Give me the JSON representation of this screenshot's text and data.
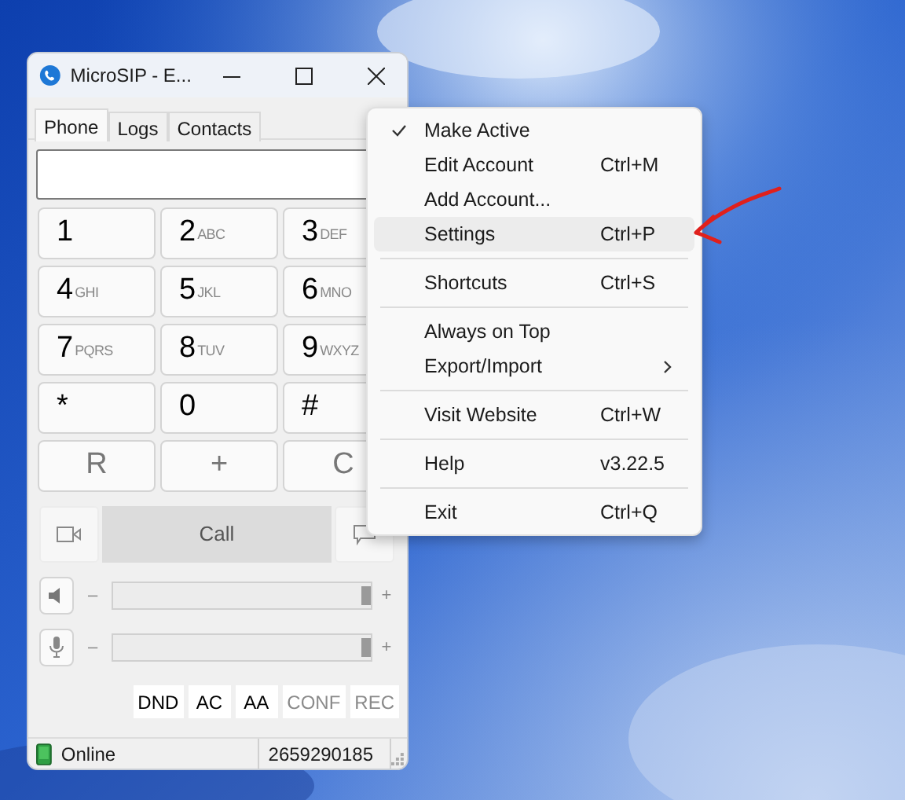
{
  "window": {
    "title": "MicroSIP - E..."
  },
  "tabs": [
    {
      "label": "Phone",
      "selected": true
    },
    {
      "label": "Logs",
      "selected": false
    },
    {
      "label": "Contacts",
      "selected": false
    }
  ],
  "keypad": [
    [
      {
        "kind": "digit",
        "main": "1"
      },
      {
        "kind": "digit",
        "main": "2",
        "sub": "ABC"
      },
      {
        "kind": "digit",
        "main": "3",
        "sub": "DEF"
      }
    ],
    [
      {
        "kind": "digit",
        "main": "4",
        "sub": "GHI"
      },
      {
        "kind": "digit",
        "main": "5",
        "sub": "JKL"
      },
      {
        "kind": "digit",
        "main": "6",
        "sub": "MNO"
      }
    ],
    [
      {
        "kind": "digit",
        "main": "7",
        "sub": "PQRS"
      },
      {
        "kind": "digit",
        "main": "8",
        "sub": "TUV"
      },
      {
        "kind": "digit",
        "main": "9",
        "sub": "WXYZ"
      }
    ],
    [
      {
        "kind": "digit",
        "main": "*"
      },
      {
        "kind": "digit",
        "main": "0"
      },
      {
        "kind": "digit",
        "main": "#"
      }
    ],
    [
      {
        "kind": "action",
        "main": "R"
      },
      {
        "kind": "action",
        "main": "+"
      },
      {
        "kind": "action",
        "main": "C"
      }
    ]
  ],
  "call_button": {
    "label": "Call",
    "disabled": true
  },
  "volume": [
    {
      "kind": "speaker",
      "minus": "–",
      "plus": "+",
      "level": 1
    },
    {
      "kind": "microphone",
      "minus": "–",
      "plus": "+",
      "level": 1
    }
  ],
  "feature_buttons": [
    {
      "label": "DND",
      "disabled": false
    },
    {
      "label": "AC",
      "disabled": false
    },
    {
      "label": "AA",
      "disabled": false
    },
    {
      "label": "CONF",
      "disabled": true
    },
    {
      "label": "REC",
      "disabled": true
    }
  ],
  "status_bar": {
    "status": "Online",
    "number": "2659290185"
  },
  "context_menu": [
    [
      {
        "label": "Make Active",
        "checked": true,
        "selected": false
      },
      {
        "label": "Edit Account",
        "shortcut": "Ctrl+M",
        "checked": false,
        "selected": false
      },
      {
        "label": "Add Account...",
        "checked": false,
        "selected": false
      },
      {
        "label": "Settings",
        "shortcut": "Ctrl+P",
        "checked": false,
        "selected": true
      }
    ],
    [
      {
        "label": "Shortcuts",
        "shortcut": "Ctrl+S",
        "checked": false,
        "selected": false
      }
    ],
    [
      {
        "label": "Always on Top",
        "checked": false,
        "selected": false
      },
      {
        "label": "Export/Import",
        "submenu": true,
        "checked": false,
        "selected": false
      }
    ],
    [
      {
        "label": "Visit Website",
        "shortcut": "Ctrl+W",
        "checked": false,
        "selected": false
      }
    ],
    [
      {
        "label": "Help",
        "shortcut": "v3.22.5",
        "checked": false,
        "selected": false
      }
    ],
    [
      {
        "label": "Exit",
        "shortcut": "Ctrl+Q",
        "checked": false,
        "selected": false
      }
    ]
  ]
}
